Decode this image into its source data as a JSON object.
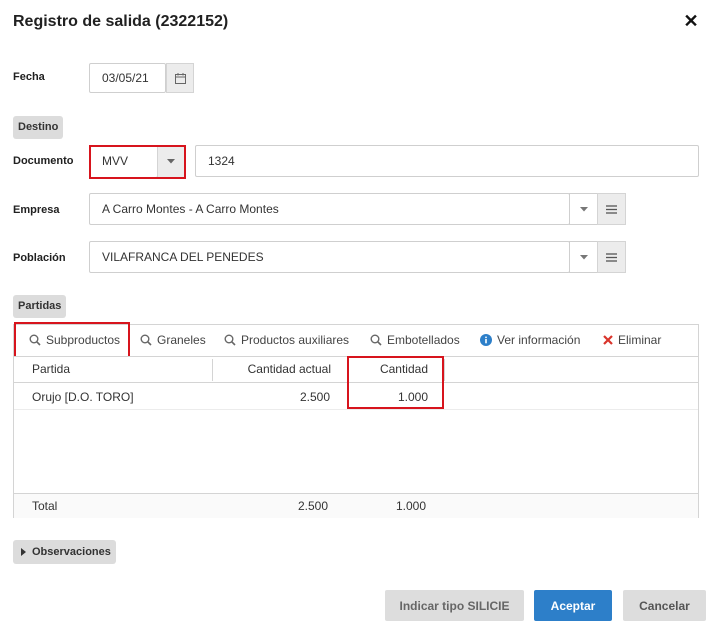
{
  "dialog": {
    "title": "Registro de salida (2322152)",
    "close_symbol": "✕"
  },
  "fecha": {
    "label": "Fecha",
    "value": "03/05/21"
  },
  "destino": {
    "section_label": "Destino"
  },
  "documento": {
    "label": "Documento",
    "type_value": "MVV",
    "number_value": "1324"
  },
  "empresa": {
    "label": "Empresa",
    "value": "A Carro Montes - A Carro Montes"
  },
  "poblacion": {
    "label": "Población",
    "value": "VILAFRANCA DEL PENEDES"
  },
  "partidas": {
    "section_label": "Partidas",
    "toolbar": {
      "subproductos": "Subproductos",
      "graneles": "Graneles",
      "productos_auxiliares": "Productos auxiliares",
      "embotellados": "Embotellados",
      "ver_informacion": "Ver información",
      "eliminar": "Eliminar"
    },
    "columns": {
      "partida": "Partida",
      "cantidad_actual": "Cantidad actual",
      "cantidad": "Cantidad"
    },
    "rows": [
      {
        "partida": "Orujo [D.O. TORO]",
        "cantidad_actual": "2.500",
        "cantidad": "1.000"
      }
    ],
    "total": {
      "label": "Total",
      "cantidad_actual": "2.500",
      "cantidad": "1.000"
    }
  },
  "observaciones": {
    "label": "Observaciones"
  },
  "footer": {
    "silicie": "Indicar tipo SILICIE",
    "aceptar": "Aceptar",
    "cancelar": "Cancelar"
  },
  "colors": {
    "accent": "#2d7fc9",
    "highlight": "#d7141d",
    "info": "#2d7fc9",
    "delete": "#d9342b"
  }
}
